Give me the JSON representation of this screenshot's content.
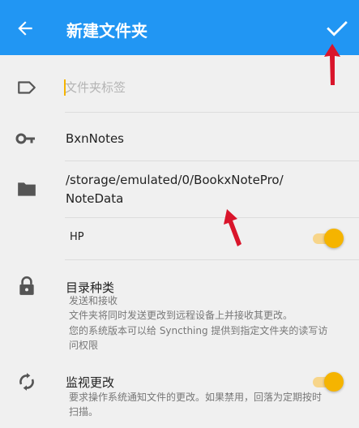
{
  "header": {
    "title": "新建文件夹",
    "back_icon": "arrow-left-icon",
    "confirm_icon": "checkmark-icon",
    "background": "#2196f3"
  },
  "folder_label": {
    "placeholder": "文件夹标签",
    "value": ""
  },
  "folder_id": {
    "value": "BxnNotes"
  },
  "folder_path": {
    "line1": "/storage/emulated/0/BookxNotePro/",
    "line2": "NoteData"
  },
  "device_share": {
    "name": "HP",
    "enabled": true
  },
  "folder_type": {
    "title": "目录种类",
    "value": "发送和接收",
    "desc_line1": "文件夹将同时发送更改到远程设备上并接收其更改。",
    "desc_line2": "您的系统版本可以给 Syncthing 提供到指定文件夹的读写访",
    "desc_line3": "问权限"
  },
  "watch_changes": {
    "title": "监视更改",
    "desc_line1": "要求操作系统通知文件的更改。如果禁用，回落为定期按时",
    "desc_line2": "扫描。",
    "enabled": true
  },
  "accent_color": "#f5b400",
  "annotation_color": "#d9152b"
}
